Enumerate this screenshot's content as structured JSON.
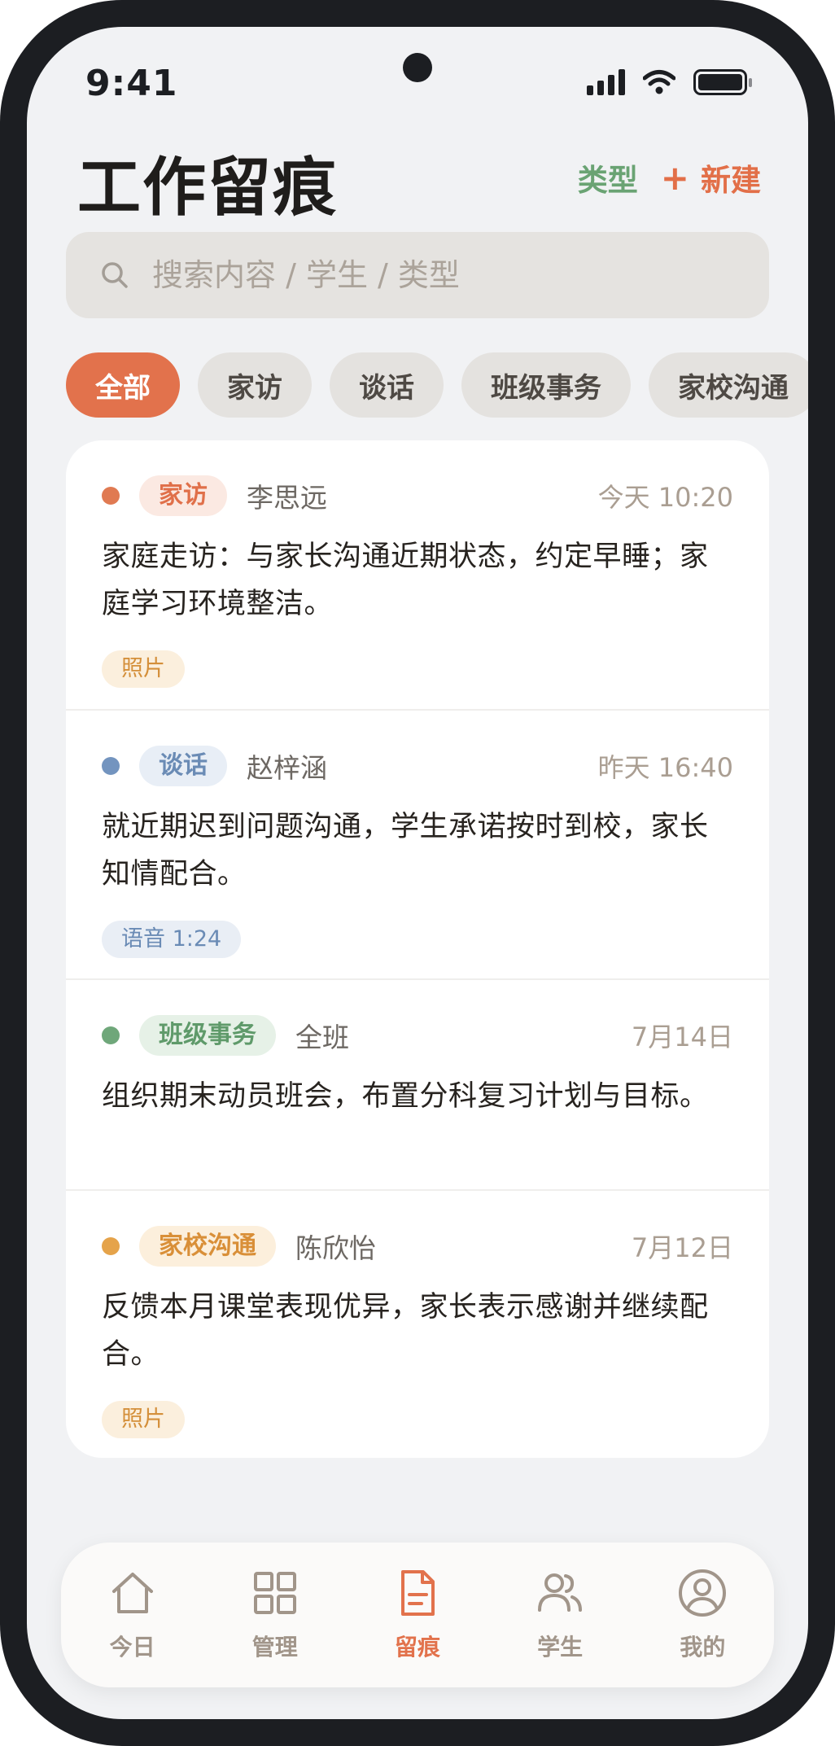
{
  "status_bar": {
    "time": "9:41"
  },
  "header": {
    "title": "工作留痕",
    "type_label": "类型",
    "new_plus": "+",
    "new_label": "新建"
  },
  "search": {
    "placeholder": "搜索内容 / 学生 / 类型"
  },
  "filters": [
    {
      "label": "全部",
      "active": true
    },
    {
      "label": "家访",
      "active": false
    },
    {
      "label": "谈话",
      "active": false
    },
    {
      "label": "班级事务",
      "active": false
    },
    {
      "label": "家校沟通",
      "active": false
    }
  ],
  "records": [
    {
      "type": "家访",
      "student": "李思远",
      "time": "今天 10:20",
      "content": "家庭走访：与家长沟通近期状态，约定早睡；家庭学习环境整洁。",
      "attachment": "照片"
    },
    {
      "type": "谈话",
      "student": "赵梓涵",
      "time": "昨天 16:40",
      "content": "就近期迟到问题沟通，学生承诺按时到校，家长知情配合。",
      "attachment": "语音 1:24"
    },
    {
      "type": "班级事务",
      "student": "全班",
      "time": "7月14日",
      "content": "组织期末动员班会，布置分科复习计划与目标。",
      "attachment": ""
    },
    {
      "type": "家校沟通",
      "student": "陈欣怡",
      "time": "7月12日",
      "content": "反馈本月课堂表现优异，家长表示感谢并继续配合。",
      "attachment": "照片"
    }
  ],
  "type_colors": {
    "home_visit": {
      "dot": "#e07a52",
      "tag_bg": "#fbe9e2",
      "tag_text": "#e0704a"
    },
    "talk": {
      "dot": "#7394bf",
      "tag_bg": "#e8eef6",
      "tag_text": "#6a8bb5"
    },
    "class_affairs": {
      "dot": "#6fa77a",
      "tag_bg": "#e6f1e7",
      "tag_text": "#5f9a6a"
    },
    "home_school": {
      "dot": "#e5a34a",
      "tag_bg": "#fcefdc",
      "tag_text": "#d98f38"
    }
  },
  "bottom_nav": [
    {
      "label": "今日",
      "icon": "home-icon",
      "active": false
    },
    {
      "label": "管理",
      "icon": "grid-icon",
      "active": false
    },
    {
      "label": "留痕",
      "icon": "document-icon",
      "active": true
    },
    {
      "label": "学生",
      "icon": "users-icon",
      "active": false
    },
    {
      "label": "我的",
      "icon": "profile-icon",
      "active": false
    }
  ],
  "accent_color": "#e2724c"
}
